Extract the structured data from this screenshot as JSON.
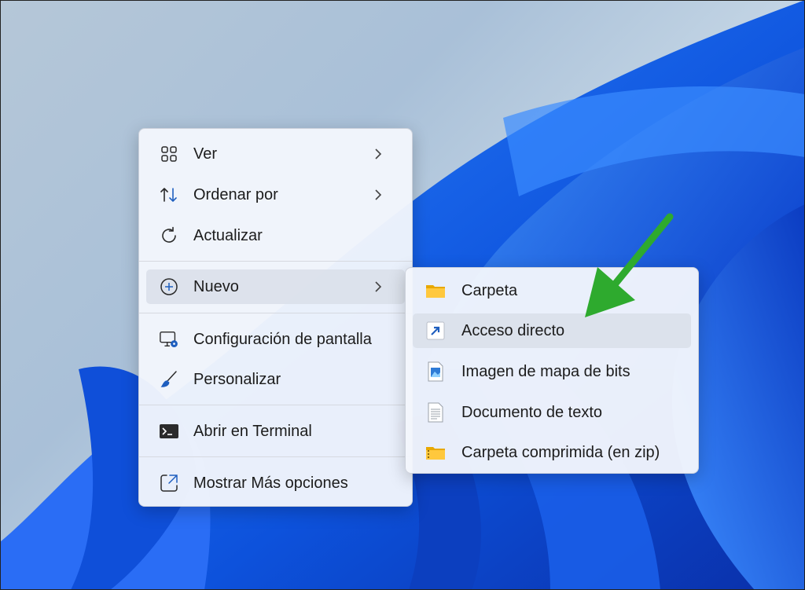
{
  "context_menu": {
    "items": [
      {
        "label": "Ver",
        "icon": "grid-view-icon",
        "has_submenu": true
      },
      {
        "label": "Ordenar por",
        "icon": "sort-arrows-icon",
        "has_submenu": true
      },
      {
        "label": "Actualizar",
        "icon": "refresh-icon",
        "has_submenu": false
      },
      {
        "label": "Nuevo",
        "icon": "plus-circle-icon",
        "has_submenu": true
      },
      {
        "label": "Configuración de pantalla",
        "icon": "display-settings-icon",
        "has_submenu": false
      },
      {
        "label": "Personalizar",
        "icon": "brush-icon",
        "has_submenu": false
      },
      {
        "label": "Abrir en Terminal",
        "icon": "terminal-icon",
        "has_submenu": false
      },
      {
        "label": "Mostrar Más opciones",
        "icon": "more-options-icon",
        "has_submenu": false
      }
    ],
    "active_item": "Nuevo"
  },
  "submenu_nuevo": {
    "items": [
      {
        "label": "Carpeta",
        "icon": "folder-icon"
      },
      {
        "label": "Acceso directo",
        "icon": "shortcut-icon"
      },
      {
        "label": "Imagen de mapa de bits",
        "icon": "bitmap-icon"
      },
      {
        "label": "Documento de texto",
        "icon": "text-document-icon"
      },
      {
        "label": "Carpeta comprimida (en zip)",
        "icon": "zip-folder-icon"
      }
    ],
    "highlighted_item": "Acceso directo"
  },
  "annotation": {
    "icon": "green-arrow-icon",
    "color": "#2eaa2e"
  },
  "colors": {
    "accent": "#1f5fbf",
    "wallpaper_blue": "#1565f0"
  }
}
